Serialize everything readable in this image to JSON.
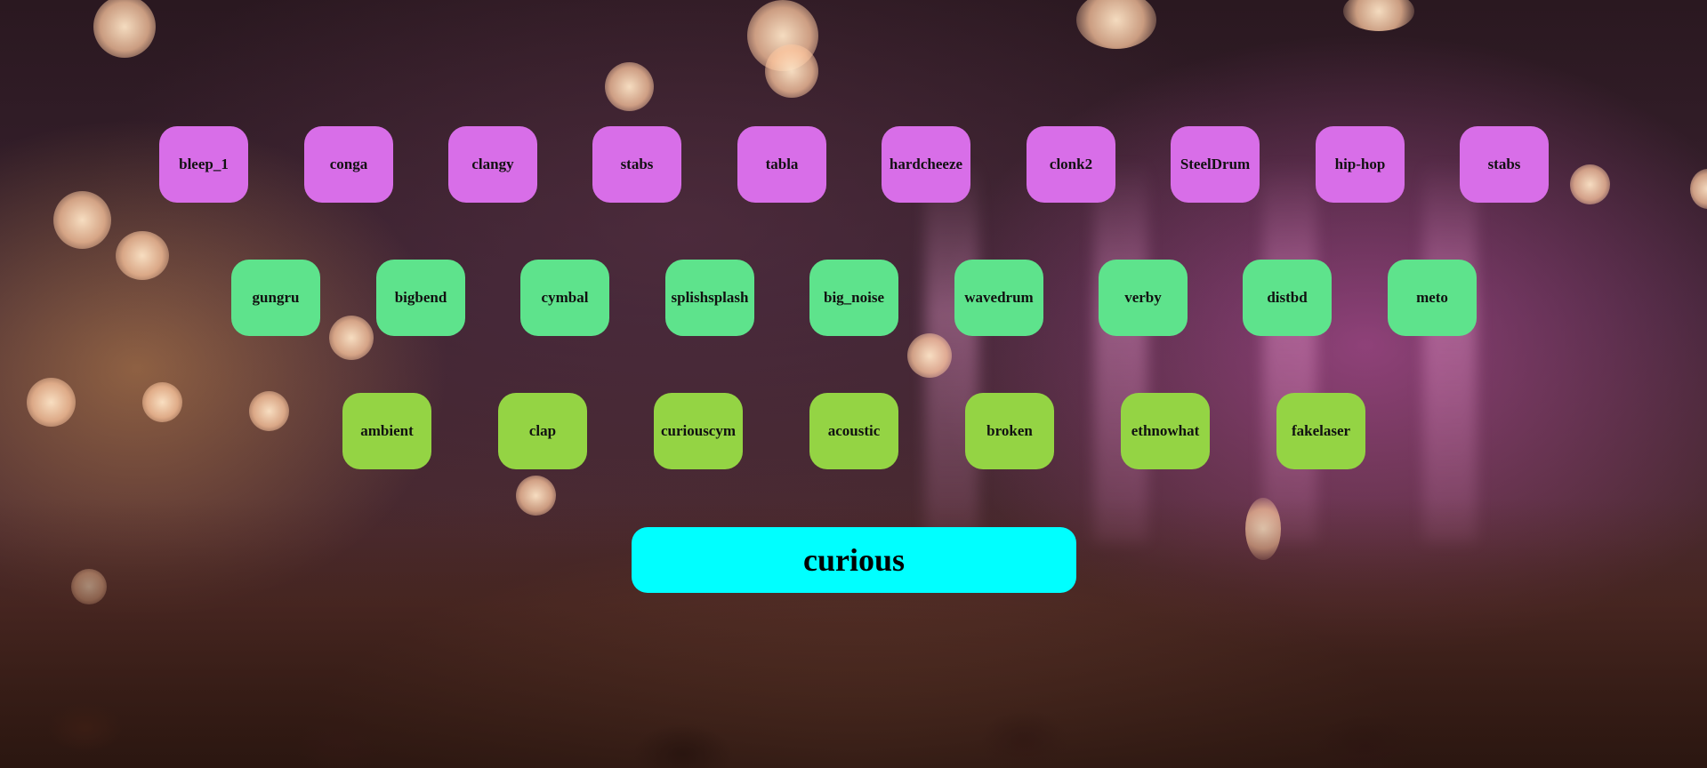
{
  "pads": {
    "row1": [
      "bleep_1",
      "conga",
      "clangy",
      "stabs",
      "tabla",
      "hardcheeze",
      "clonk2",
      "SteelDrum",
      "hip-hop",
      "stabs"
    ],
    "row2": [
      "gungru",
      "bigbend",
      "cymbal",
      "splishsplash",
      "big_noise",
      "wavedrum",
      "verby",
      "distbd",
      "meto"
    ],
    "row3": [
      "ambient",
      "clap",
      "curiouscym",
      "acoustic",
      "broken",
      "ethnowhat",
      "fakelaser"
    ]
  },
  "display": {
    "text": "curious"
  },
  "colors": {
    "row1": "#d86ee8",
    "row2": "#5ee38c",
    "row3": "#94d444",
    "display": "#00ffff"
  }
}
